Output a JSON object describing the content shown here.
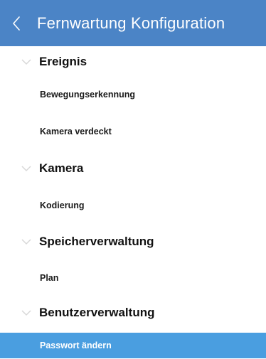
{
  "header": {
    "title": "Fernwartung Konfiguration",
    "back_icon": "chevron-left-icon",
    "background_color": "#4b84c6"
  },
  "sections": [
    {
      "label": "Ereignis",
      "items": [
        {
          "label": "Bewegungserkennung"
        },
        {
          "label": "Kamera verdeckt"
        }
      ]
    },
    {
      "label": "Kamera",
      "items": [
        {
          "label": "Kodierung"
        }
      ]
    },
    {
      "label": "Speicherverwaltung",
      "items": [
        {
          "label": "Plan"
        }
      ]
    },
    {
      "label": "Benutzerverwaltung",
      "items": [
        {
          "label": "Passwort ändern",
          "selected": true
        }
      ]
    }
  ],
  "selected_item_color": "#4a9ee0"
}
